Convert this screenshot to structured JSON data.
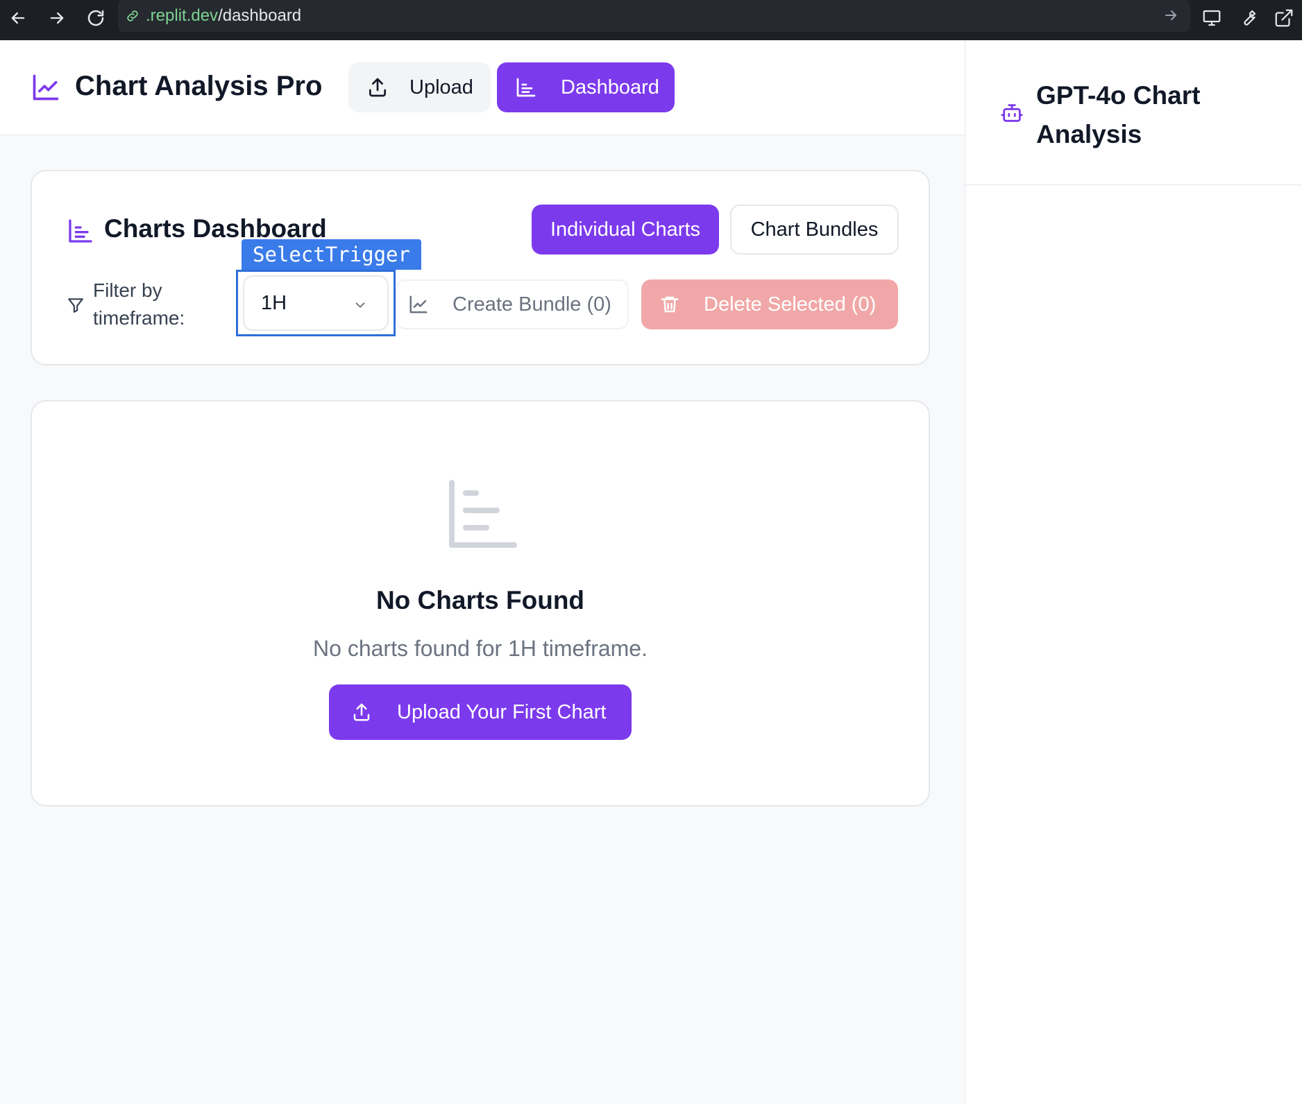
{
  "browser": {
    "url_host": ".replit.dev",
    "url_path": "/dashboard"
  },
  "header": {
    "app_title": "Chart Analysis Pro",
    "nav": {
      "upload_label": "Upload",
      "dashboard_label": "Dashboard"
    }
  },
  "right_panel": {
    "title": "GPT-4o Chart Analysis"
  },
  "dashboard": {
    "title": "Charts Dashboard",
    "tabs": {
      "individual_label": "Individual Charts",
      "bundles_label": "Chart Bundles"
    },
    "filter_label": "Filter by timeframe:",
    "select": {
      "value": "1H",
      "annotation_label": "SelectTrigger"
    },
    "create_bundle_label": "Create Bundle (0)",
    "delete_selected_label": "Delete Selected (0)"
  },
  "empty_state": {
    "title": "No Charts Found",
    "message": "No charts found for 1H timeframe.",
    "button_label": "Upload Your First Chart"
  },
  "colors": {
    "accent": "#7c3aed",
    "danger_disabled": "#f1a7a7",
    "annotation": "#3a7bea"
  },
  "icons": {
    "back": "arrow-left-icon",
    "forward": "arrow-right-icon",
    "reload": "reload-icon",
    "link": "link-icon",
    "logo": "line-chart-icon",
    "upload": "upload-icon",
    "dashboard": "bar-chart-icon",
    "robot": "robot-icon",
    "filter": "filter-icon",
    "chevron": "chevron-down-icon",
    "create_bundle": "line-chart-icon",
    "trash": "trash-icon",
    "empty": "bar-chart-icon"
  }
}
